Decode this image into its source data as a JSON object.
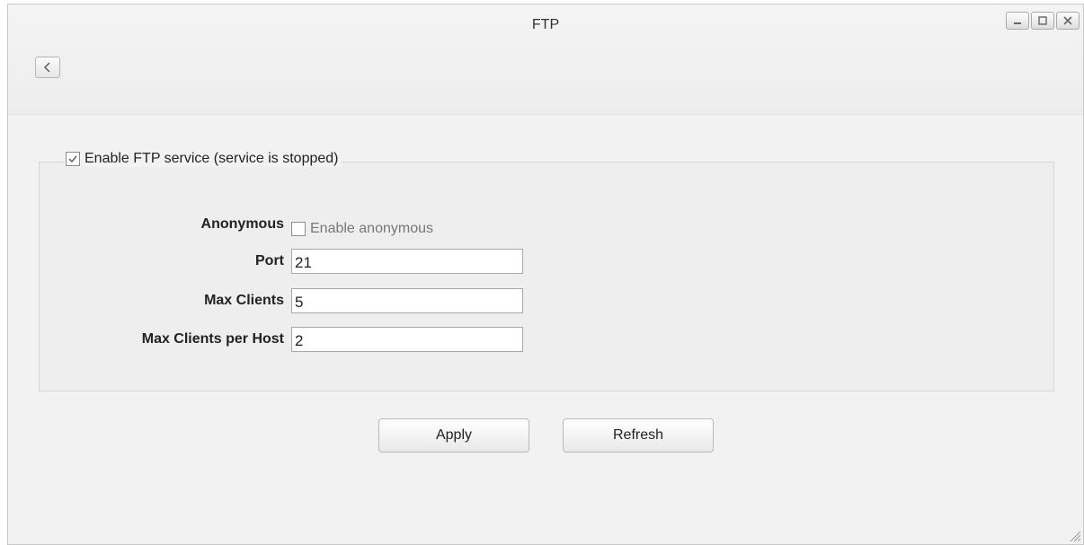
{
  "window": {
    "title": "FTP",
    "controls": [
      "minimize-icon",
      "maximize-icon",
      "close-icon"
    ],
    "back_icon": "chevron-left-icon"
  },
  "service": {
    "enable_label": "Enable FTP service (service is stopped)",
    "enabled": true
  },
  "form": {
    "anonymous_label": "Anonymous",
    "anonymous_option_label": "Enable anonymous",
    "anonymous_enabled": false,
    "port_label": "Port",
    "port_value": "21",
    "max_clients_label": "Max Clients",
    "max_clients_value": "5",
    "max_clients_per_host_label": "Max Clients per Host",
    "max_clients_per_host_value": "2"
  },
  "actions": {
    "apply_label": "Apply",
    "refresh_label": "Refresh"
  },
  "colors": {
    "window_background": "#f2f2f2",
    "fieldset_border": "#d6d6d6",
    "check_mark": "#555555"
  }
}
